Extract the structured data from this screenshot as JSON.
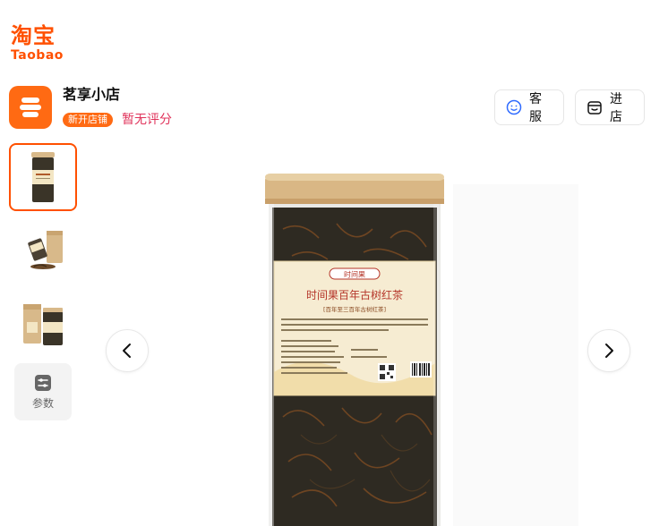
{
  "logo": {
    "cn": "淘宝",
    "en": "Taobao"
  },
  "shop": {
    "name": "茗享小店",
    "badge": "新开店铺",
    "rating": "暂无评分"
  },
  "actions": {
    "service_label": "客服",
    "store_label": "进店"
  },
  "gallery": {
    "params_label": "参数",
    "selected_index": 0
  },
  "product_label": {
    "brand": "时间果",
    "title": "时间果百年古树红茶",
    "subtitle": "[百年至三百年古树红茶]"
  },
  "colors": {
    "brand": "#ff5000",
    "badge": "#ff6a13",
    "rating": "#e0325a"
  }
}
